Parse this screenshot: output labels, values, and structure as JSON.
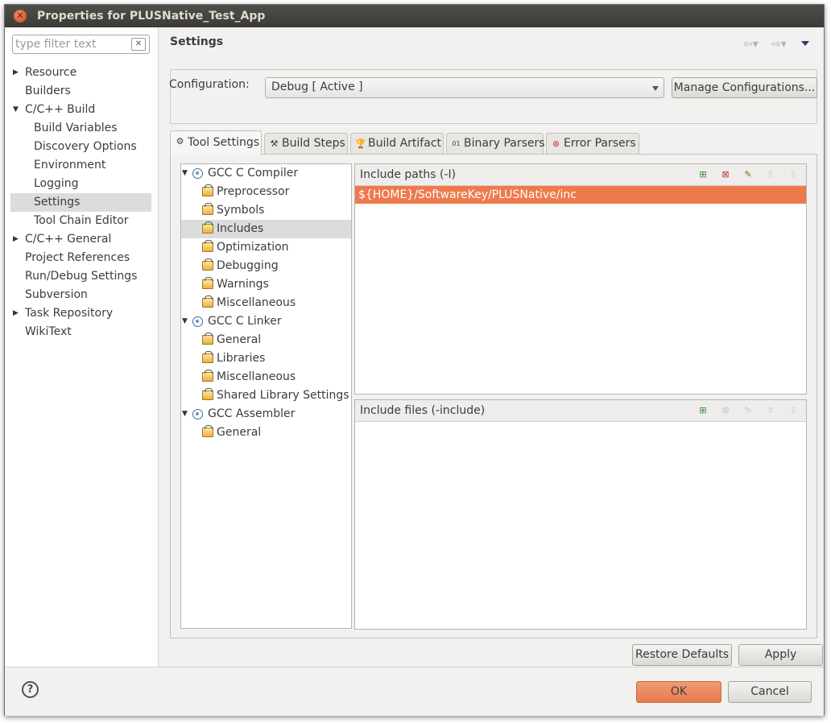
{
  "window": {
    "title": "Properties for PLUSNative_Test_App"
  },
  "filter": {
    "placeholder": "type filter text"
  },
  "nav": [
    {
      "label": "Resource",
      "arrow": "▶",
      "child": false
    },
    {
      "label": "Builders",
      "arrow": "",
      "child": false
    },
    {
      "label": "C/C++ Build",
      "arrow": "▼",
      "child": false
    },
    {
      "label": "Build Variables",
      "arrow": "",
      "child": true
    },
    {
      "label": "Discovery Options",
      "arrow": "",
      "child": true
    },
    {
      "label": "Environment",
      "arrow": "",
      "child": true
    },
    {
      "label": "Logging",
      "arrow": "",
      "child": true
    },
    {
      "label": "Settings",
      "arrow": "",
      "child": true,
      "selected": true
    },
    {
      "label": "Tool Chain Editor",
      "arrow": "",
      "child": true
    },
    {
      "label": "C/C++ General",
      "arrow": "▶",
      "child": false
    },
    {
      "label": "Project References",
      "arrow": "",
      "child": false
    },
    {
      "label": "Run/Debug Settings",
      "arrow": "",
      "child": false
    },
    {
      "label": "Subversion",
      "arrow": "",
      "child": false
    },
    {
      "label": "Task Repository",
      "arrow": "▶",
      "child": false
    },
    {
      "label": "WikiText",
      "arrow": "",
      "child": false
    }
  ],
  "header": {
    "title": "Settings"
  },
  "config": {
    "label": "Configuration:",
    "value": "Debug  [ Active ]",
    "manage_label": "Manage Configurations..."
  },
  "tabs": [
    {
      "label": "Tool Settings",
      "icon": "tool-settings-icon",
      "active": true
    },
    {
      "label": "Build Steps",
      "icon": "build-steps-icon"
    },
    {
      "label": "Build Artifact",
      "icon": "build-artifact-icon"
    },
    {
      "label": "Binary Parsers",
      "icon": "binary-parsers-icon"
    },
    {
      "label": "Error Parsers",
      "icon": "error-parsers-icon"
    }
  ],
  "tree": [
    {
      "label": "GCC C Compiler",
      "type": "parent"
    },
    {
      "label": "Preprocessor",
      "type": "child"
    },
    {
      "label": "Symbols",
      "type": "child"
    },
    {
      "label": "Includes",
      "type": "child",
      "selected": true
    },
    {
      "label": "Optimization",
      "type": "child"
    },
    {
      "label": "Debugging",
      "type": "child"
    },
    {
      "label": "Warnings",
      "type": "child"
    },
    {
      "label": "Miscellaneous",
      "type": "child"
    },
    {
      "label": "GCC C Linker",
      "type": "parent"
    },
    {
      "label": "General",
      "type": "child"
    },
    {
      "label": "Libraries",
      "type": "child"
    },
    {
      "label": "Miscellaneous",
      "type": "child"
    },
    {
      "label": "Shared Library Settings",
      "type": "child"
    },
    {
      "label": "GCC Assembler",
      "type": "parent"
    },
    {
      "label": "General",
      "type": "child"
    }
  ],
  "include_paths": {
    "title": "Include paths (-I)",
    "items": [
      "${HOME}/SoftwareKey/PLUSNative/inc"
    ]
  },
  "include_files": {
    "title": "Include files (-include)",
    "items": []
  },
  "buttons": {
    "restore": "Restore Defaults",
    "apply": "Apply",
    "ok": "OK",
    "cancel": "Cancel"
  },
  "colors": {
    "selection": "#ed7a4d",
    "ok_button": "#e57a4f"
  }
}
